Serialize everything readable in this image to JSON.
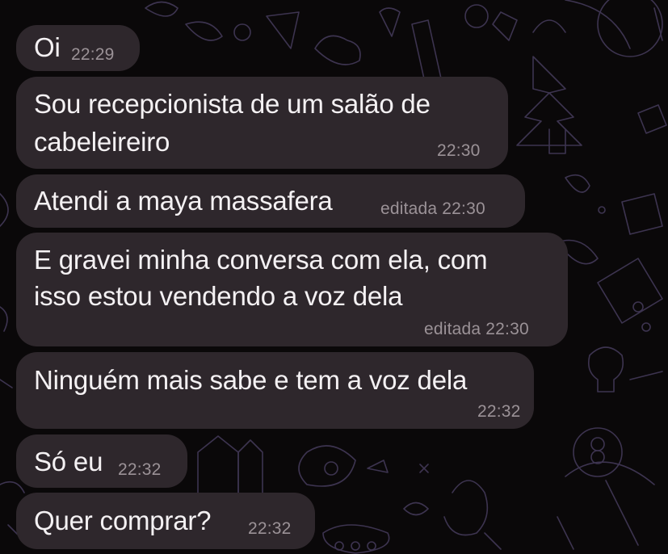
{
  "colors": {
    "background": "#0a0809",
    "bubble": "#2e272c",
    "text": "#f4f1f3",
    "meta": "#9b9297",
    "wallpaper_lines": "#3d3450"
  },
  "messages": [
    {
      "lines": [
        "Oi"
      ],
      "time": "22:29",
      "edited": ""
    },
    {
      "lines": [
        "Sou recepcionista de um salão de",
        "cabeleireiro"
      ],
      "time": "22:30",
      "edited": ""
    },
    {
      "lines": [
        "Atendi a maya massafera"
      ],
      "time": "22:30",
      "edited": "editada"
    },
    {
      "lines": [
        "E gravei minha conversa com ela, com",
        "isso estou vendendo a voz dela"
      ],
      "time": "22:30",
      "edited": "editada"
    },
    {
      "lines": [
        "Ninguém mais sabe e tem a voz dela"
      ],
      "time": "22:32",
      "edited": ""
    },
    {
      "lines": [
        "Só eu"
      ],
      "time": "22:32",
      "edited": ""
    },
    {
      "lines": [
        "Quer comprar?"
      ],
      "time": "22:32",
      "edited": ""
    }
  ]
}
